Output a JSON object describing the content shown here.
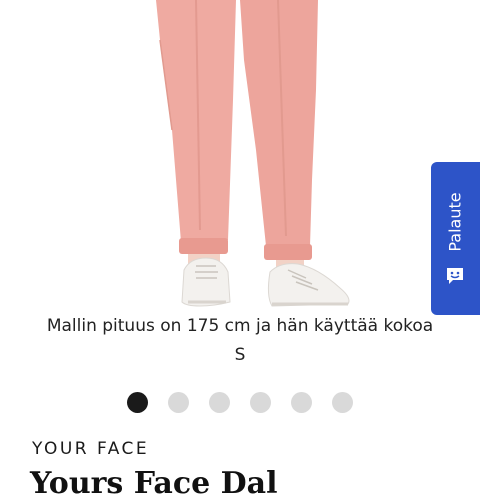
{
  "product_image": {
    "caption": "Mallin pituus on 175 cm ja hän käyttää kokoa S",
    "colors": {
      "pants": "#efaaa1",
      "shoes": "#f3f1ee"
    }
  },
  "carousel": {
    "total": 6,
    "active_index": 0,
    "colors": {
      "active": "#1a1a1a",
      "inactive": "#d9d9d9"
    }
  },
  "product": {
    "brand": "YOUR FACE",
    "title": "Yours Face Dal"
  },
  "feedback_tab": {
    "label": "Palaute",
    "icon": "smiley-chat-icon",
    "color": "#2d54c8"
  }
}
